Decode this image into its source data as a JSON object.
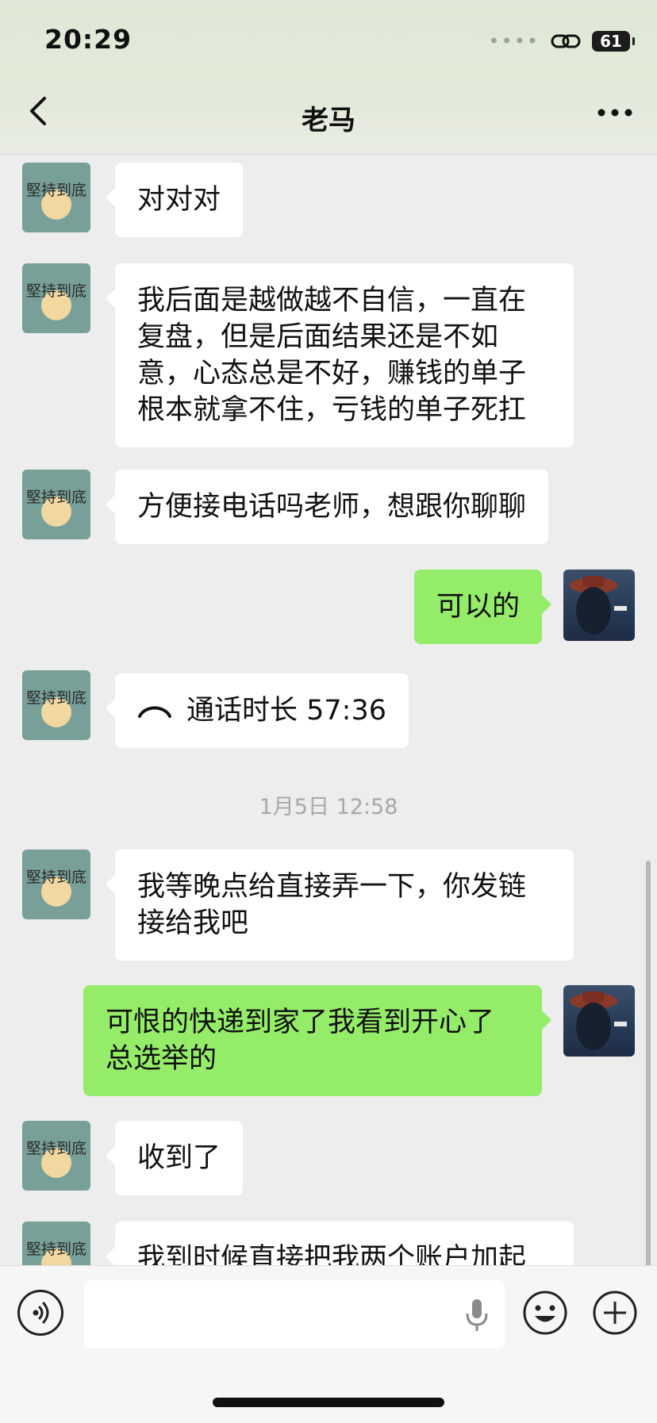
{
  "status_bar": {
    "time": "20:29",
    "battery": "61"
  },
  "header": {
    "title": "老马"
  },
  "contact_avatar_text": "堅持到底",
  "messages": [
    {
      "side": "left",
      "text": "对对对"
    },
    {
      "side": "left",
      "text": "我后面是越做越不自信，一直在复盘，但是后面结果还是不如意，心态总是不好，赚钱的单子根本就拿不住，亏钱的单子死扛"
    },
    {
      "side": "left",
      "text": "方便接电话吗老师，想跟你聊聊"
    },
    {
      "side": "right",
      "text": "可以的"
    },
    {
      "side": "left",
      "type": "call",
      "text": "通话时长 57:36"
    },
    {
      "type": "timestamp",
      "text": "1月5日 12:58"
    },
    {
      "side": "left",
      "text": "我等晚点给直接弄一下，你发链接给我吧"
    },
    {
      "side": "right",
      "text": "可恨的快递到家了我看到开心了总选举的"
    },
    {
      "side": "left",
      "text": "收到了"
    },
    {
      "side": "left",
      "text": "我到时候直接把我两个账户加起"
    }
  ],
  "input_bar": {
    "placeholder": ""
  },
  "colors": {
    "sent_bubble": "#95ec69",
    "received_bubble": "#ffffff",
    "background": "#ededed"
  }
}
